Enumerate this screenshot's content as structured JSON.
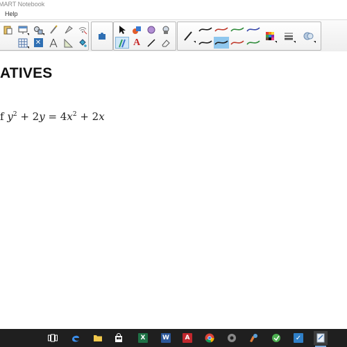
{
  "window": {
    "title": "MART Notebook"
  },
  "menu": {
    "items": [
      "Help"
    ]
  },
  "toolbar": {
    "pen_colors": [
      "#1a1a1a",
      "#c0392b",
      "#2e8b3a",
      "#3949ab",
      "#1a1a1a",
      "#1a1a1a",
      "#c0392b",
      "#2e8b3a",
      "#3949ab"
    ]
  },
  "page": {
    "heading": "ATIVES",
    "equation_prefix": "f ",
    "eq_y": "y",
    "eq_exp1": "2",
    "eq_plus_2y": " + 2",
    "eq_y2": "y",
    "eq_equals": " = 4",
    "eq_x": "x",
    "eq_exp2": "2",
    "eq_plus_2x": " + 2",
    "eq_x2": "x"
  },
  "taskbar": {
    "word_label": "W",
    "acrobat_label": "A",
    "excel_label": "X"
  }
}
